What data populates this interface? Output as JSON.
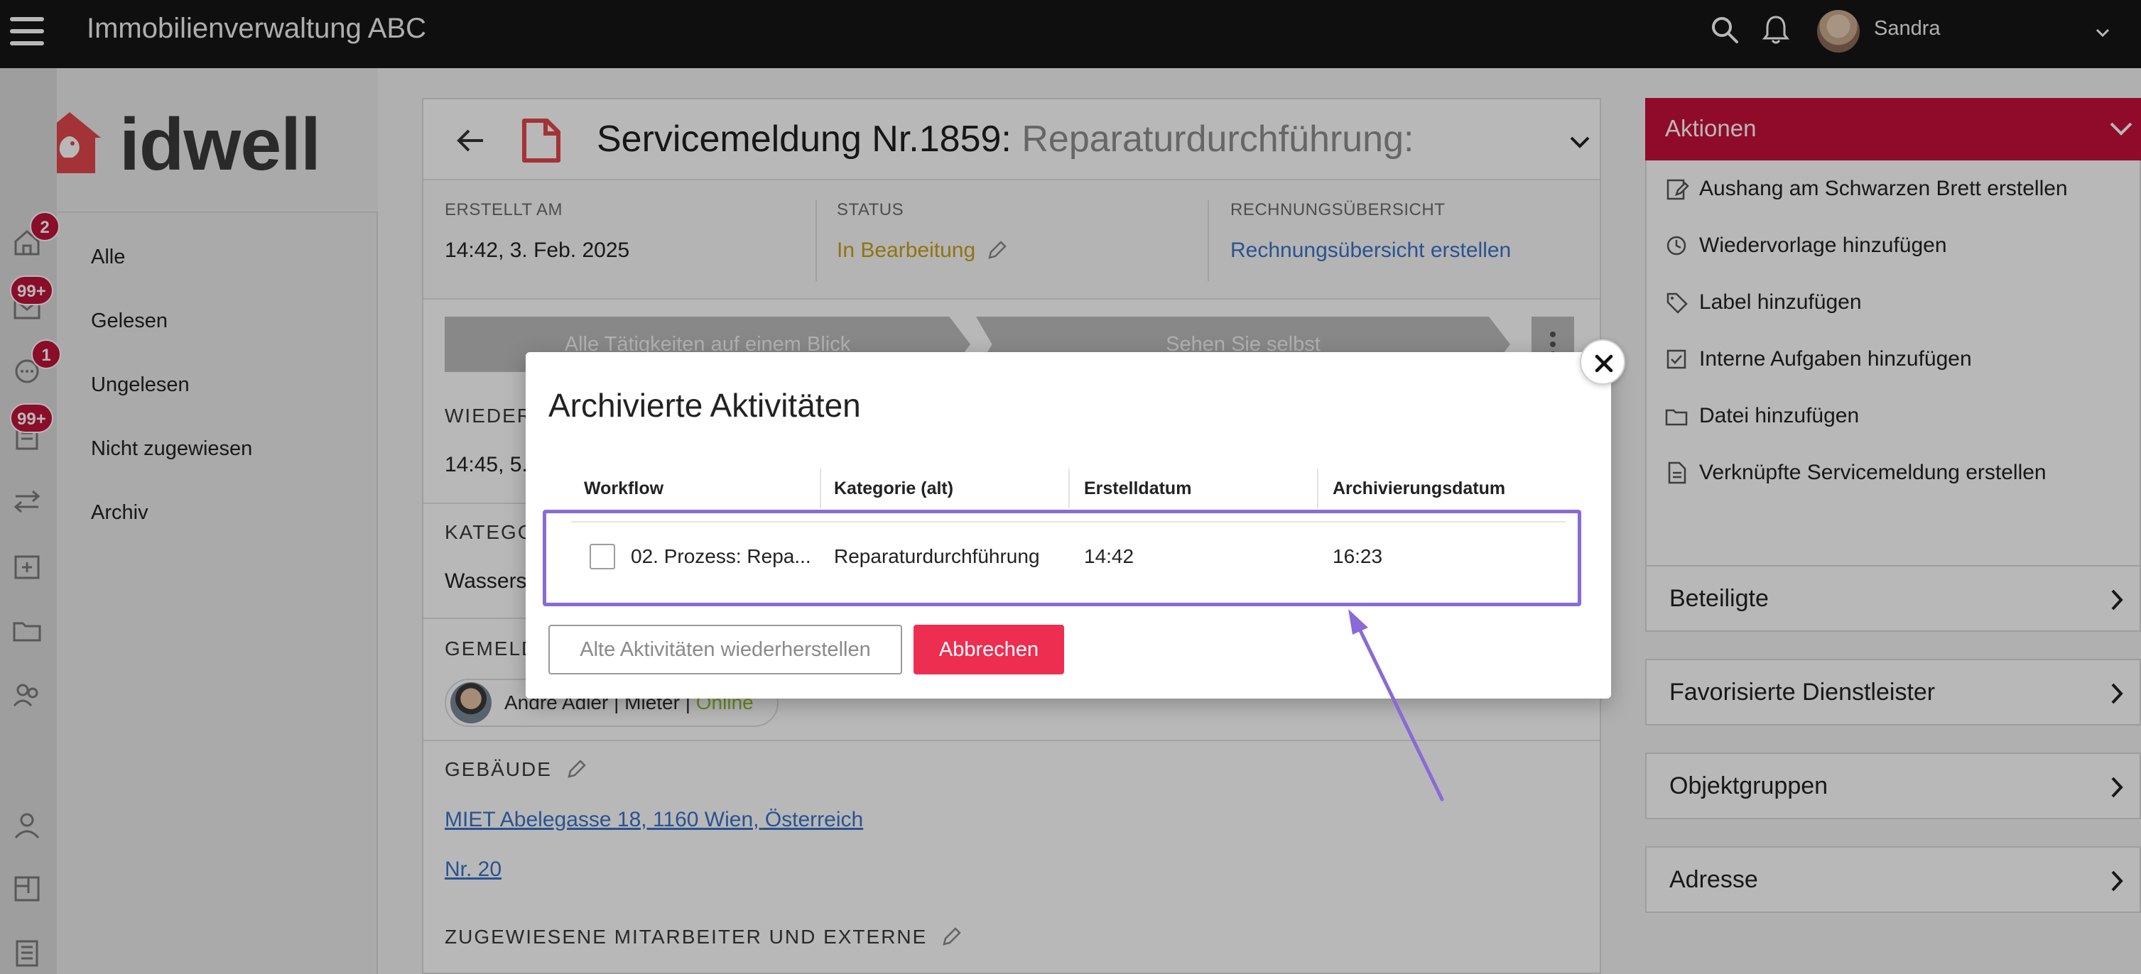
{
  "topbar": {
    "title": "Immobilienverwaltung ABC",
    "user": "Sandra"
  },
  "logo": {
    "text": "idwell"
  },
  "rail": {
    "badges": {
      "home": "2",
      "mail": "99+",
      "chat": "1",
      "notes": "99+"
    }
  },
  "sidebar": {
    "items": [
      "Alle",
      "Gelesen",
      "Ungelesen",
      "Nicht zugewiesen",
      "Archiv"
    ]
  },
  "main": {
    "title": "Servicemeldung Nr.1859:",
    "subtitle": "Reparaturdurchführung:",
    "info": {
      "created_label": "ERSTELLT AM",
      "created_value": "14:42, 3. Feb. 2025",
      "status_label": "STATUS",
      "status_value": "In Bearbeitung",
      "invoice_label": "RECHNUNGSÜBERSICHT",
      "invoice_link": "Rechnungsübersicht erstellen"
    },
    "banner": [
      "Alle Tätigkeiten auf einem Blick",
      "Sehen Sie selbst"
    ],
    "sections": {
      "wieder_label": "WIEDER",
      "wieder_value": "14:45, 5.",
      "katego_label": "KATEGO",
      "katego_value": "Wassers",
      "gemeld_label": "GEMELD",
      "reporter_name": "André Adler | Mieter |",
      "reporter_status": "Online",
      "building_label": "GEBÄUDE",
      "building_link": "MIET Abelegasse 18, 1160 Wien, Österreich",
      "unit_link": "Nr. 20",
      "assigned_label": "ZUGEWIESENE MITARBEITER UND EXTERNE"
    }
  },
  "actions": {
    "header": "Aktionen",
    "items": [
      {
        "label": "Aushang am Schwarzen Brett erstellen",
        "icon": "edit-note-icon"
      },
      {
        "label": "Wiedervorlage hinzufügen",
        "icon": "clock-icon"
      },
      {
        "label": "Label hinzufügen",
        "icon": "tag-icon"
      },
      {
        "label": "Interne Aufgaben hinzufügen",
        "icon": "checkbox-icon"
      },
      {
        "label": "Datei hinzufügen",
        "icon": "folder-icon"
      },
      {
        "label": "Verknüpfte Servicemeldung erstellen",
        "icon": "document-icon"
      }
    ],
    "accordions": [
      "Beteiligte",
      "Favorisierte Dienstleister",
      "Objektgruppen",
      "Adresse"
    ]
  },
  "modal": {
    "title": "Archivierte Aktivitäten",
    "columns": [
      "Workflow",
      "Kategorie (alt)",
      "Erstelldatum",
      "Archivierungsdatum"
    ],
    "rows": [
      {
        "workflow": "02. Prozess: Repa...",
        "category": "Reparaturdurchführung",
        "created": "14:42",
        "archived": "16:23"
      }
    ],
    "restore_button": "Alte Aktivitäten wiederherstellen",
    "cancel_button": "Abbrechen"
  },
  "colors": {
    "accent": "#c8103b",
    "highlight": "#8a6ad6",
    "cancel": "#ee2e50",
    "status": "#c9a019",
    "link": "#3a73c9"
  }
}
